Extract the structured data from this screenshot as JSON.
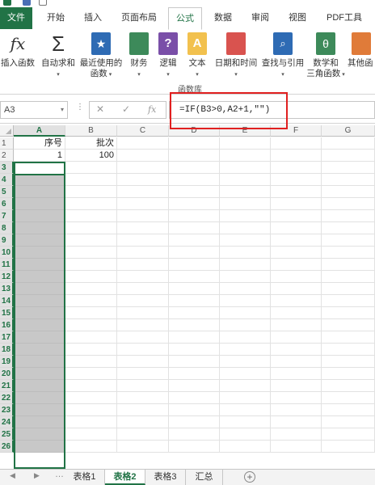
{
  "ribbon_tabs": [
    "文件",
    "开始",
    "插入",
    "页面布局",
    "公式",
    "数据",
    "审阅",
    "视图",
    "PDF工具"
  ],
  "ribbon_buttons": [
    {
      "label": "插入函数",
      "icon": "fx-icon"
    },
    {
      "label": "自动求和",
      "icon": "sigma-icon"
    },
    {
      "label": "最近使用的",
      "label2": "函数",
      "icon": "recent-functions-icon"
    },
    {
      "label": "财务",
      "icon": "financial-icon"
    },
    {
      "label": "逻辑",
      "icon": "logical-icon"
    },
    {
      "label": "文本",
      "icon": "text-function-icon"
    },
    {
      "label": "日期和时间",
      "icon": "date-time-icon"
    },
    {
      "label": "查找与引用",
      "icon": "lookup-reference-icon"
    },
    {
      "label": "数学和",
      "label2": "三角函数",
      "icon": "math-trig-icon"
    },
    {
      "label": "其他函",
      "icon": "more-functions-icon"
    }
  ],
  "ribbon_group_label": "函数库",
  "formula_bar": {
    "name_box": "A3",
    "cancel": "✕",
    "enter": "✓",
    "fx": "fx",
    "formula": "=IF(B3>0,A2+1,\"\")"
  },
  "columns": [
    "A",
    "B",
    "C",
    "D",
    "E",
    "F",
    "G"
  ],
  "rows": [
    "1",
    "2",
    "3",
    "4",
    "5",
    "6",
    "7",
    "8",
    "9",
    "10",
    "11",
    "12",
    "13",
    "14",
    "15",
    "16",
    "17",
    "18",
    "19",
    "20",
    "21",
    "22",
    "23",
    "24",
    "25",
    "26"
  ],
  "cells": {
    "A1": "序号",
    "B1": "批次",
    "A2": "1",
    "B2": "100"
  },
  "sheets": [
    "表格1",
    "表格2",
    "表格3",
    "汇总"
  ],
  "active_sheet": "表格2",
  "colors": {
    "accent": "#217346",
    "highlight": "#e02020"
  }
}
